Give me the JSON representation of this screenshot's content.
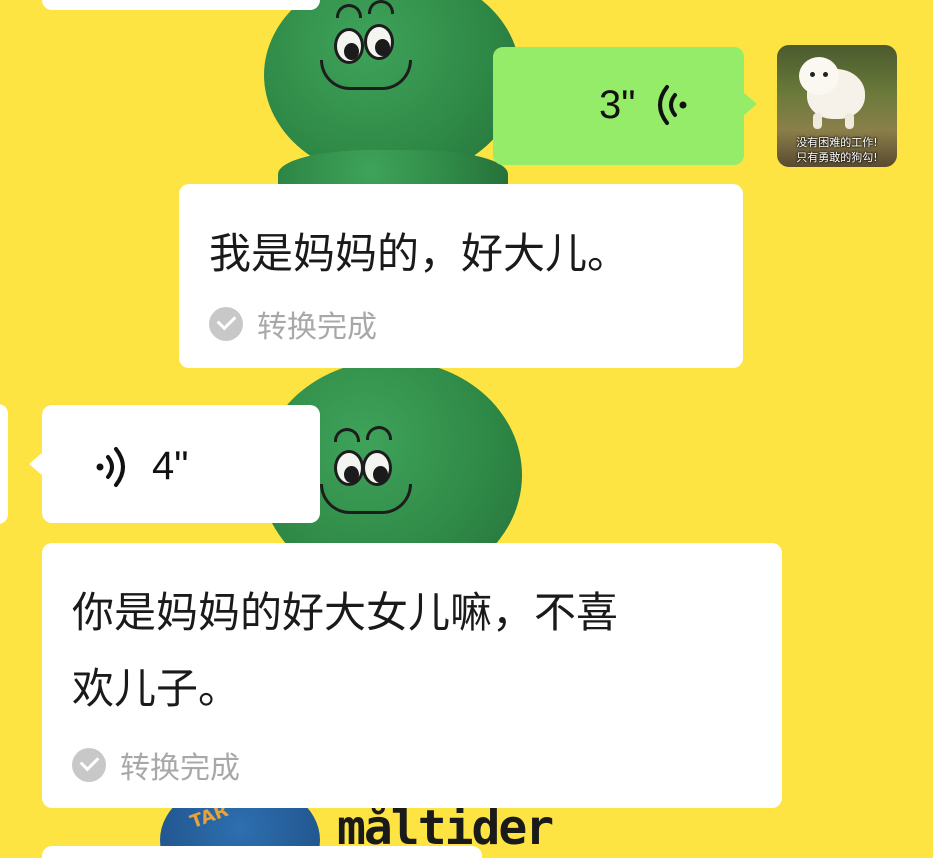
{
  "messages": {
    "outgoing_voice": {
      "duration": "3\"",
      "sender": "self"
    },
    "outgoing_transcript": {
      "text": "我是妈妈的，好大儿。",
      "status": "转换完成"
    },
    "incoming_voice": {
      "duration": "4\"",
      "sender": "other"
    },
    "incoming_transcript": {
      "line1": "你是妈妈的好大女儿嘛，不喜",
      "line2": "欢儿子。",
      "status": "转换完成"
    }
  },
  "avatar": {
    "caption_line1": "没有困难的工作!",
    "caption_line2": "只有勇敢的狗勾!"
  },
  "wallpaper": {
    "brand_text": "måltider",
    "disc_text": "TAR"
  },
  "colors": {
    "background": "#fde442",
    "outgoing_bubble": "#95ec69",
    "incoming_bubble": "#ffffff",
    "status_gray": "#a8a8a8"
  },
  "icons": {
    "outgoing_voice": "voice-wave-left-icon",
    "incoming_voice": "voice-wave-right-icon",
    "status": "check-circle-icon"
  }
}
